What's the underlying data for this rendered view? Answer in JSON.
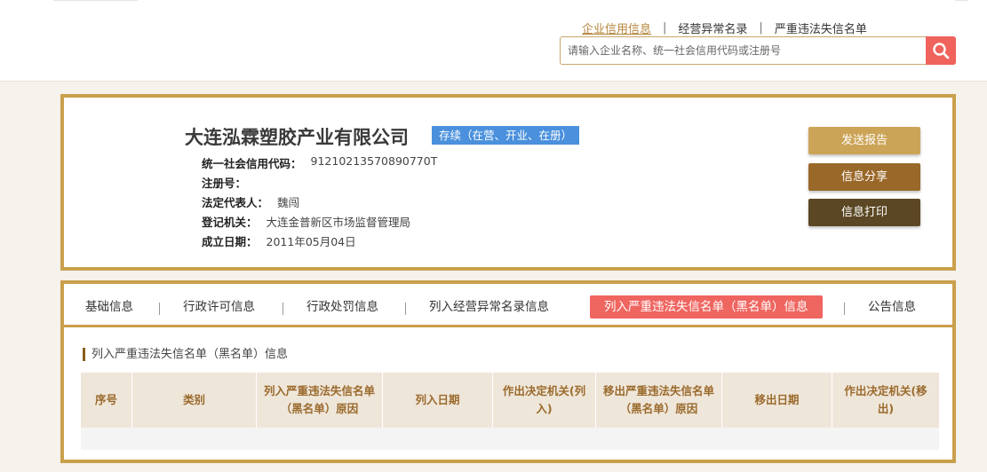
{
  "header": {
    "nav": [
      {
        "label": "企业信用信息",
        "active": true
      },
      {
        "label": "经营异常名录",
        "active": false
      },
      {
        "label": "严重违法失信名单",
        "active": false
      }
    ],
    "nav_separator": "|",
    "search": {
      "placeholder": "请输入企业名称、统一社会信用代码或注册号",
      "value": "",
      "icon": "search-icon"
    }
  },
  "company": {
    "name": "大连泓霖塑胶产业有限公司",
    "status": "存续（在营、开业、在册）",
    "fields": [
      {
        "label": "统一社会信用代码：",
        "value": "91210213570890770T"
      },
      {
        "label": "注册号：",
        "value": ""
      },
      {
        "label": "法定代表人：",
        "value": "魏闯"
      },
      {
        "label": "登记机关：",
        "value": "大连金普新区市场监督管理局"
      },
      {
        "label": "成立日期：",
        "value": "2011年05月04日"
      }
    ],
    "actions": {
      "report": "发送报告",
      "share": "信息分享",
      "print": "信息打印"
    }
  },
  "tabs": [
    {
      "label": "基础信息",
      "active": false
    },
    {
      "label": "行政许可信息",
      "active": false
    },
    {
      "label": "行政处罚信息",
      "active": false
    },
    {
      "label": "列入经营异常名录信息",
      "active": false
    },
    {
      "label": "列入严重违法失信名单（黑名单）信息",
      "active": true
    },
    {
      "label": "公告信息",
      "active": false
    }
  ],
  "section": {
    "title": "列入严重违法失信名单（黑名单）信息",
    "columns": [
      "序号",
      "类别",
      "列入严重违法失信名单（黑名单）原因",
      "列入日期",
      "作出决定机关(列入)",
      "移出严重违法失信名单（黑名单）原因",
      "移出日期",
      "作出决定机关(移出)"
    ],
    "rows": []
  },
  "colors": {
    "gold_border": "#caa04c",
    "search_button": "#f0625c",
    "status_badge": "#4a90dd",
    "active_tab": "#ef6560",
    "header_text": "#9a6a2c"
  }
}
